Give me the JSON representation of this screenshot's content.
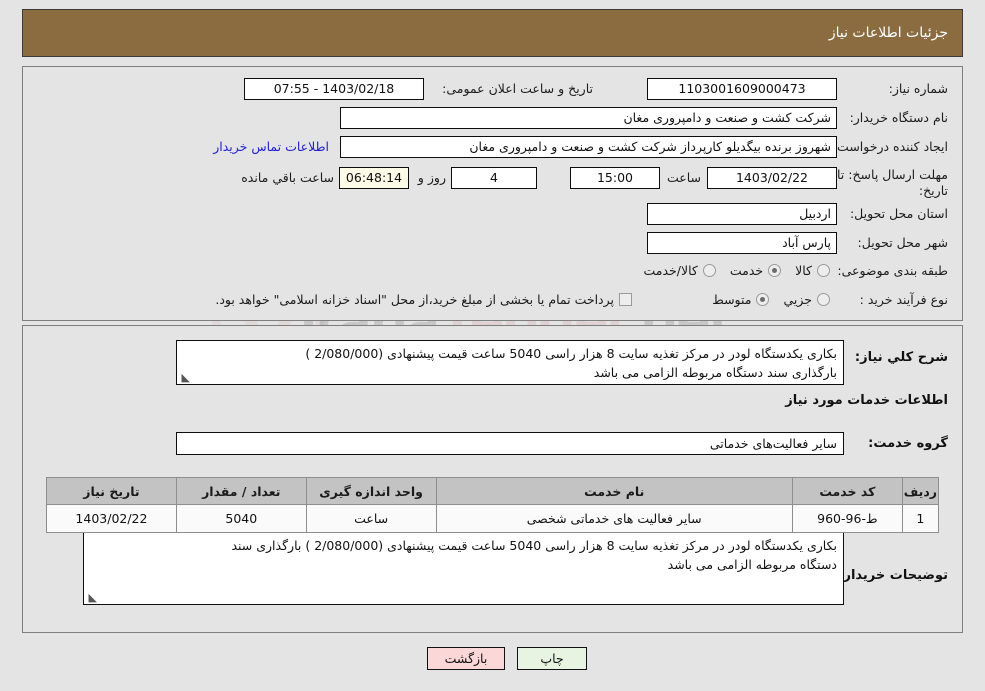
{
  "header": {
    "title": "جزئیات اطلاعات نیاز"
  },
  "form": {
    "need_number_label": "شماره نیاز:",
    "need_number_value": "1103001609000473",
    "public_announce_label": "تاریخ و ساعت اعلان عمومی:",
    "public_announce_value": "1403/02/18 - 07:55",
    "buyer_org_label": "نام دستگاه خریدار:",
    "buyer_org_value": "شرکت کشت و صنعت و دامپروری مغان",
    "requester_label": "ایجاد کننده درخواست:",
    "requester_value": "شهروز برنده بیگدیلو کارپرداز شرکت کشت و صنعت و دامپروری مغان",
    "contact_link": "اطلاعات تماس خریدار",
    "deadline_label_line1": "مهلت ارسال پاسخ: تا",
    "deadline_label_line2": "تاریخ:",
    "deadline_date": "1403/02/22",
    "hour_word": "ساعت",
    "deadline_time": "15:00",
    "days_left": "4",
    "days_word": "روز و",
    "timer_value": "06:48:14",
    "timer_word": "ساعت باقي مانده",
    "province_label": "استان محل تحویل:",
    "province_value": "اردبیل",
    "city_label": "شهر محل تحویل:",
    "city_value": "پارس آباد",
    "category_label": "طبقه بندی موضوعی:",
    "category_options": [
      "کالا",
      "خدمت",
      "کالا/خدمت"
    ],
    "category_selected": "خدمت",
    "process_label": "نوع فرآیند خرید :",
    "process_options": [
      "جزیي",
      "متوسط"
    ],
    "process_selected": "متوسط",
    "payment_checkbox_text": "پرداخت تمام یا بخشی از مبلغ خرید،از محل \"اسناد خزانه اسلامی\" خواهد بود.",
    "payment_checked": false
  },
  "need_summary": {
    "label": "شرح کلي نیاز:",
    "line1": "بکاری یکدستگاه لودر در مرکز تغذیه سایت  8 هزار راسی 5040 ساعت قیمت پیشنهادی (2/080/000 )",
    "line2": "بارگذاری سند دستگاه مربوطه الزامی می باشد"
  },
  "services_section": {
    "heading": "اطلاعات خدمات مورد نیاز",
    "group_label": "گروه خدمت:",
    "group_value": "سایر فعالیت‌های خدماتی"
  },
  "table": {
    "columns": [
      "ردیف",
      "کد خدمت",
      "نام خدمت",
      "واحد اندازه گیری",
      "تعداد / مقدار",
      "تاریخ نیاز"
    ],
    "rows": [
      {
        "radif": "1",
        "code": "ط-96-960",
        "name": "سایر فعالیت های خدماتی شخصی",
        "unit": "ساعت",
        "qty": "5040",
        "date": "1403/02/22"
      }
    ]
  },
  "buyer_notes": {
    "label": "توضیحات خریدار:",
    "line1": "بکاری یکدستگاه لودر در مرکز تغذیه سایت  8 هزار راسی 5040 ساعت قیمت پیشنهادی (2/080/000 ) بارگذاری سند",
    "line2": "دستگاه مربوطه الزامی می باشد"
  },
  "buttons": {
    "print": "چاپ",
    "back": "بازگشت"
  },
  "watermark": {
    "text_a": "Irana",
    "text_b": "Tender",
    "text_c": ".net"
  },
  "colors": {
    "header_bg": "#8B6B40",
    "page_bg": "#E4E4E4",
    "link": "#2222CC",
    "table_header_bg": "#C3C3C3",
    "print_btn_bg": "#E7F4E2",
    "back_btn_bg": "#FBD7D7",
    "timer_bg": "#FBFBE8"
  }
}
